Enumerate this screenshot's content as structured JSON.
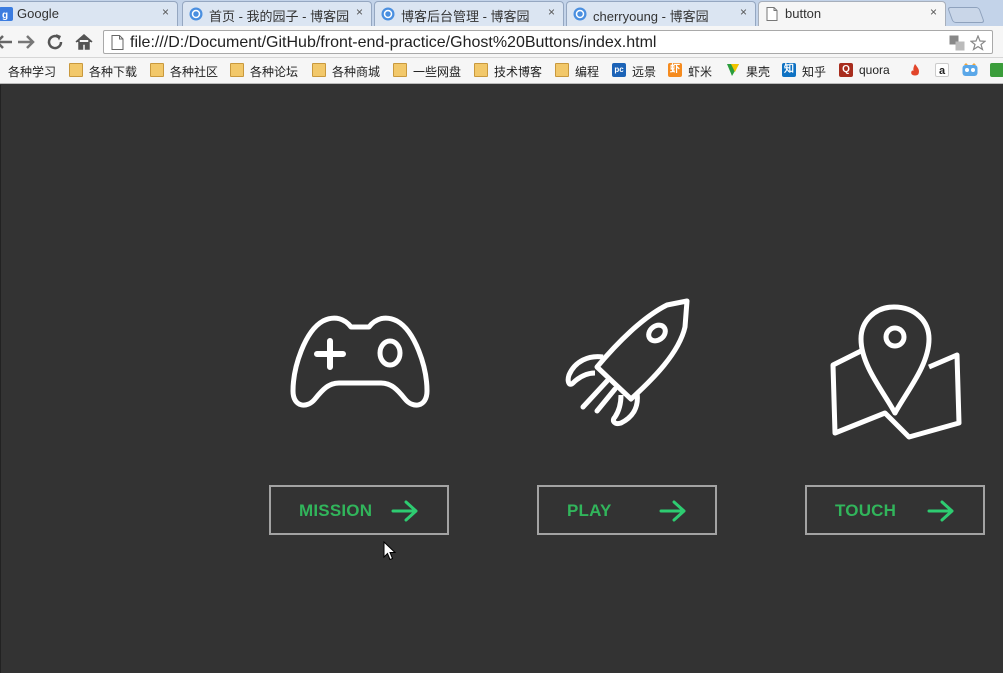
{
  "browser": {
    "tabs": [
      {
        "title": "Google",
        "active": false
      },
      {
        "title": "首页 - 我的园子 - 博客园",
        "active": false
      },
      {
        "title": "博客后台管理 - 博客园",
        "active": false
      },
      {
        "title": "cherryoung - 博客园",
        "active": false
      },
      {
        "title": "button",
        "active": true
      }
    ],
    "close_glyph": "×",
    "url": "file:///D:/Document/GitHub/front-end-practice/Ghost%20Buttons/index.html",
    "bookmarks": [
      {
        "label": "各种学习",
        "icon": "none"
      },
      {
        "label": "各种下载",
        "icon": "folder-icon"
      },
      {
        "label": "各种社区",
        "icon": "folder-icon"
      },
      {
        "label": "各种论坛",
        "icon": "folder-icon"
      },
      {
        "label": "各种商城",
        "icon": "folder-icon"
      },
      {
        "label": "一些网盘",
        "icon": "folder-icon"
      },
      {
        "label": "技术博客",
        "icon": "folder-icon"
      },
      {
        "label": "编程",
        "icon": "folder-icon"
      },
      {
        "label": "远景",
        "icon": "pc-logo-icon"
      },
      {
        "label": "虾米",
        "icon": "xiami-logo-icon"
      },
      {
        "label": "果壳",
        "icon": "guokr-logo-icon"
      },
      {
        "label": "知乎",
        "icon": "zhihu-logo-icon"
      },
      {
        "label": "quora",
        "icon": "quora-logo-icon"
      }
    ],
    "bookmark_glyphs": {
      "pc": "pc",
      "xiami": "虾",
      "zhihu": "知",
      "quora": "Q",
      "amazon": "a"
    }
  },
  "page": {
    "buttons": [
      {
        "label": "MISSION",
        "icon": "gamepad-icon"
      },
      {
        "label": "PLAY",
        "icon": "rocket-icon"
      },
      {
        "label": "TOUCH",
        "icon": "map-pin-icon"
      }
    ]
  },
  "colors": {
    "page_background": "#333333",
    "icon_stroke": "#ffffff",
    "button_border": "rgba(255,255,255,0.55)",
    "button_text": "#31b55b",
    "arrow": "#2ecc71"
  }
}
